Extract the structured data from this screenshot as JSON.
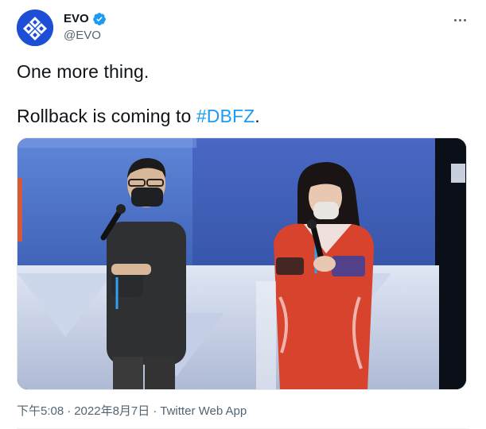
{
  "author": {
    "display_name": "EVO",
    "handle": "@EVO",
    "verified": true,
    "avatar_icon": "evo-logo"
  },
  "tweet": {
    "line1": "One more thing.",
    "line2_prefix": "Rollback is coming to ",
    "hashtag": "#DBFZ",
    "line2_suffix": "."
  },
  "media": {
    "type": "photo",
    "icon": "photo"
  },
  "meta": {
    "time": "下午5:08",
    "sep1": "·",
    "date": "2022年8月7日",
    "sep2": "·",
    "source": "Twitter Web App"
  },
  "colors": {
    "accent": "#1d9bf0",
    "text_secondary": "#536471",
    "avatar_bg": "#1d4fd6"
  }
}
